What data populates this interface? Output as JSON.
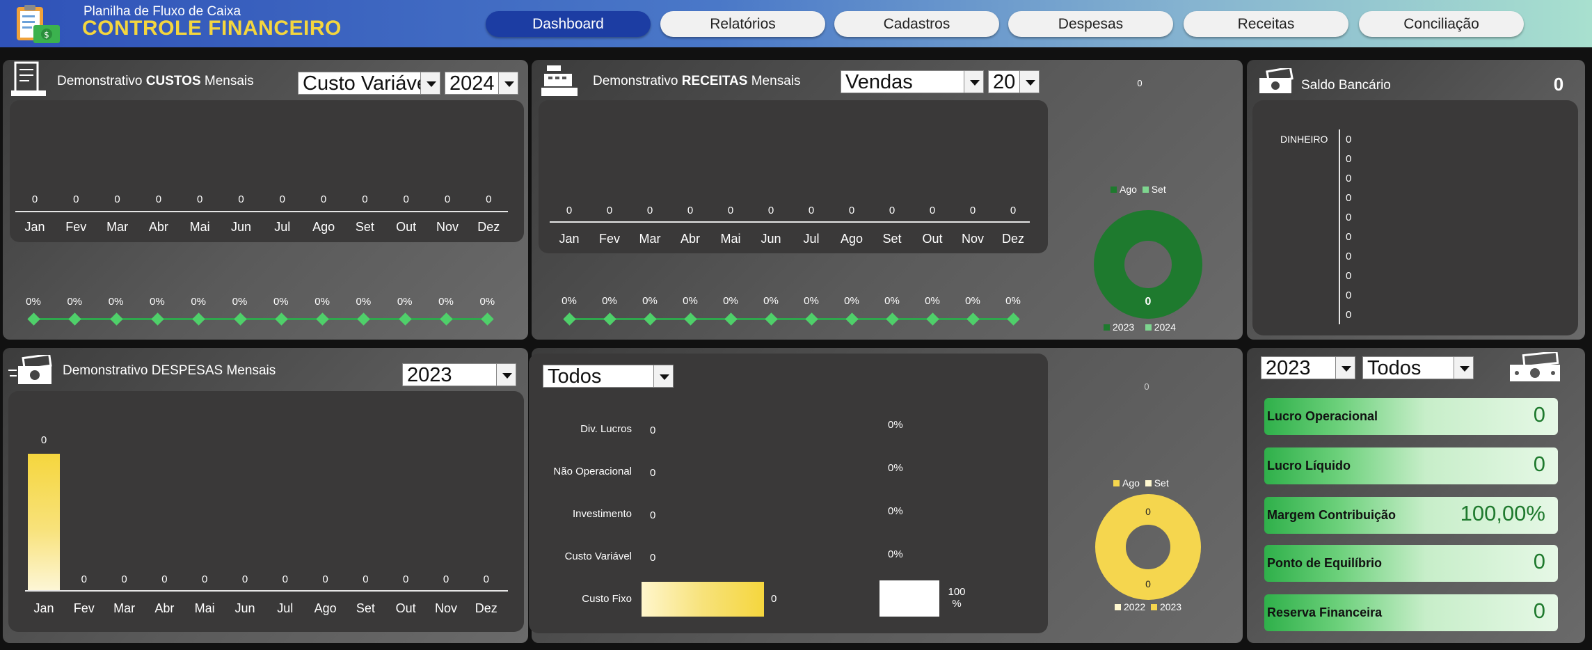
{
  "header": {
    "subtitle": "Planilha de Fluxo de Caixa",
    "title": "CONTROLE FINANCEIRO",
    "logo_icon": "clipboard-money-icon"
  },
  "nav": [
    {
      "label": "Dashboard",
      "active": true
    },
    {
      "label": "Relatórios",
      "active": false
    },
    {
      "label": "Cadastros",
      "active": false
    },
    {
      "label": "Despesas",
      "active": false
    },
    {
      "label": "Receitas",
      "active": false
    },
    {
      "label": "Conciliação",
      "active": false
    }
  ],
  "months": [
    "Jan",
    "Fev",
    "Mar",
    "Abr",
    "Mai",
    "Jun",
    "Jul",
    "Ago",
    "Set",
    "Out",
    "Nov",
    "Dez"
  ],
  "custos": {
    "title_pre": "Demonstrativo ",
    "title_bold": "CUSTOS",
    "title_post": " Mensais",
    "icon": "receipt-icon",
    "type_select": "Custo Variável",
    "year_select": "2024",
    "values": [
      "0",
      "0",
      "0",
      "0",
      "0",
      "0",
      "0",
      "0",
      "0",
      "0",
      "0",
      "0"
    ],
    "percents": [
      "0%",
      "0%",
      "0%",
      "0%",
      "0%",
      "0%",
      "0%",
      "0%",
      "0%",
      "0%",
      "0%",
      "0%"
    ]
  },
  "receitas": {
    "title_pre": "Demonstrativo ",
    "title_bold": "RECEITAS",
    "title_post": " Mensais",
    "icon": "cash-register-icon",
    "type_select": "Vendas",
    "year_select": "20",
    "values": [
      "0",
      "0",
      "0",
      "0",
      "0",
      "0",
      "0",
      "0",
      "0",
      "0",
      "0",
      "0"
    ],
    "percents": [
      "0%",
      "0%",
      "0%",
      "0%",
      "0%",
      "0%",
      "0%",
      "0%",
      "0%",
      "0%",
      "0%",
      "0%"
    ],
    "donut": {
      "top_label": "0",
      "legend_top": [
        "Ago",
        "Set"
      ],
      "center_value": "0",
      "legend_bottom": [
        "2023",
        "2024"
      ],
      "colors": {
        "primary": "#1e7a2e",
        "secondary": "#7ed58f"
      }
    }
  },
  "saldo": {
    "title": "Saldo Bancário",
    "icon": "money-bills-icon",
    "value": "0",
    "axis_label": "DINHEIRO",
    "ticks": [
      "0",
      "0",
      "0",
      "0",
      "0",
      "0",
      "0",
      "0",
      "0",
      "0"
    ]
  },
  "despesas": {
    "title": "Demonstrativo DESPESAS Mensais",
    "icon": "money-bills-icon",
    "year_select": "2023",
    "values": [
      "0",
      "0",
      "0",
      "0",
      "0",
      "0",
      "0",
      "0",
      "0",
      "0",
      "0",
      "0"
    ],
    "bar_color": "#f7dc5a"
  },
  "categorias": {
    "filter_select": "Todos",
    "rows": [
      {
        "label": "Div. Lucros",
        "value": "0",
        "percent": "0%"
      },
      {
        "label": "Não Operacional",
        "value": "0",
        "percent": "0%"
      },
      {
        "label": "Investimento",
        "value": "0",
        "percent": "0%"
      },
      {
        "label": "Custo Variável",
        "value": "0",
        "percent": "0%"
      },
      {
        "label": "Custo Fixo",
        "value": "0",
        "percent": "100\n%"
      }
    ],
    "donut": {
      "top_label": "0",
      "legend_top": [
        "Ago",
        "Set"
      ],
      "inner_top": "0",
      "center_value": "0",
      "legend_bottom": [
        "2022",
        "2023"
      ],
      "colors": {
        "primary": "#f5d64e",
        "secondary": "#fff8d0"
      }
    }
  },
  "indicadores": {
    "year_select": "2023",
    "filter_select": "Todos",
    "icon": "money-bills-icon",
    "items": [
      {
        "label": "Lucro Operacional",
        "value": "0"
      },
      {
        "label": "Lucro Líquido",
        "value": "0"
      },
      {
        "label": "Margem Contribuição",
        "value": "100,00%"
      },
      {
        "label": "Ponto de Equilíbrio",
        "value": "0"
      },
      {
        "label": "Reserva Financeira",
        "value": "0"
      }
    ]
  }
}
